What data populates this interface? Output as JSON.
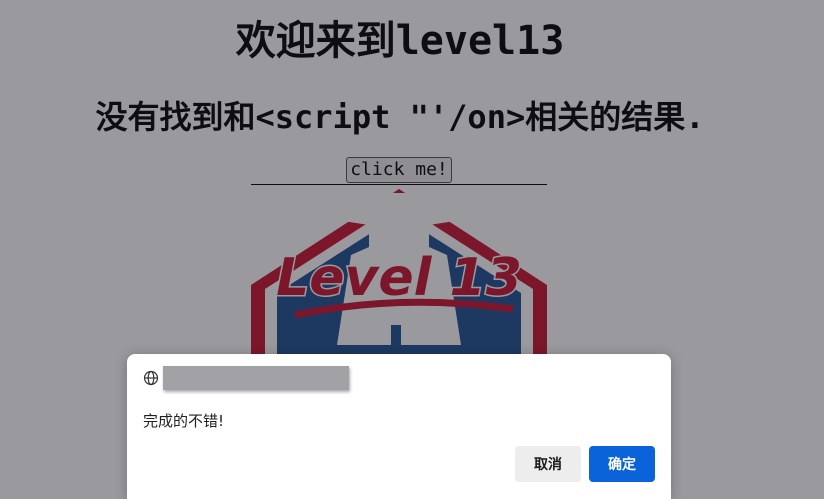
{
  "page": {
    "heading": "欢迎来到level13",
    "result_text": "没有找到和<script \"'/on>相关的结果.",
    "click_button": "click me!",
    "logo_text": "Level 13"
  },
  "dialog": {
    "message": "完成的不错!",
    "cancel_label": "取消",
    "ok_label": "确定"
  },
  "colors": {
    "logo_red": "#c8102e",
    "logo_blue": "#1d4f91",
    "ok_button": "#0b63d9"
  }
}
